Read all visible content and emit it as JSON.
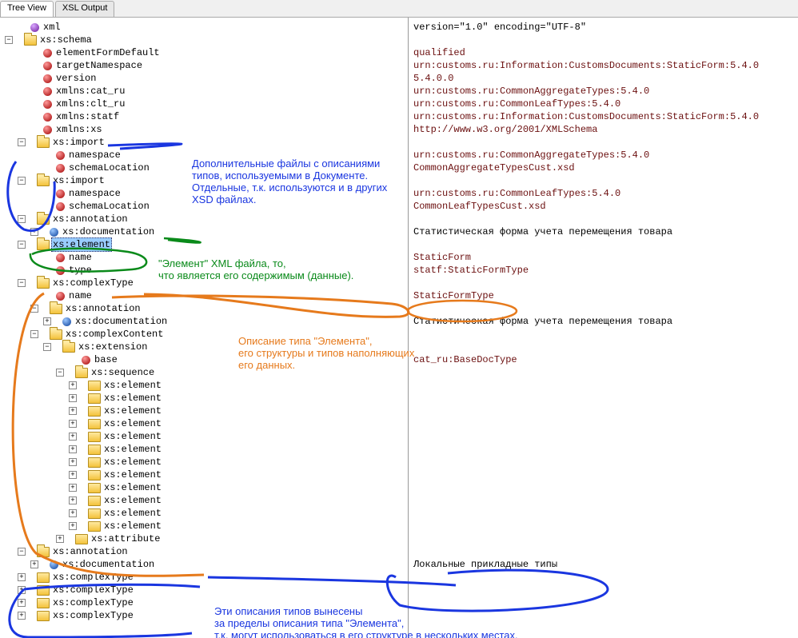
{
  "tabs": {
    "tree_view": "Tree View",
    "xsl_output": "XSL Output"
  },
  "tree": {
    "xml": "xml",
    "schema": "xs:schema",
    "attrs": {
      "elementFormDefault": "elementFormDefault",
      "targetNamespace": "targetNamespace",
      "version": "version",
      "xmlns_cat_ru": "xmlns:cat_ru",
      "xmlns_clt_ru": "xmlns:clt_ru",
      "xmlns_statf": "xmlns:statf",
      "xmlns_xs": "xmlns:xs"
    },
    "import1": {
      "label": "xs:import",
      "namespace": "namespace",
      "schemaLocation": "schemaLocation"
    },
    "import2": {
      "label": "xs:import",
      "namespace": "namespace",
      "schemaLocation": "schemaLocation"
    },
    "annotation": "xs:annotation",
    "documentation": "xs:documentation",
    "element": "xs:element",
    "name": "name",
    "type": "type",
    "complexType": "xs:complexType",
    "complexContent": "xs:complexContent",
    "extension": "xs:extension",
    "base": "base",
    "sequence": "xs:sequence",
    "xs_element": "xs:element",
    "xs_attribute": "xs:attribute"
  },
  "values": {
    "xml_decl": "version=\"1.0\" encoding=\"UTF-8\"",
    "qualified": "qualified",
    "targetNs": "urn:customs.ru:Information:CustomsDocuments:StaticForm:5.4.0",
    "version": "5.4.0.0",
    "cat_ru": "urn:customs.ru:CommonAggregateTypes:5.4.0",
    "clt_ru": "urn:customs.ru:CommonLeafTypes:5.4.0",
    "statf": "urn:customs.ru:Information:CustomsDocuments:StaticForm:5.4.0",
    "xs": "http://www.w3.org/2001/XMLSchema",
    "imp1_ns": "urn:customs.ru:CommonAggregateTypes:5.4.0",
    "imp1_loc": "CommonAggregateTypesCust.xsd",
    "imp2_ns": "urn:customs.ru:CommonLeafTypes:5.4.0",
    "imp2_loc": "CommonLeafTypesCust.xsd",
    "doc1": "Статистическая форма учета перемещения товара",
    "el_name": "StaticForm",
    "el_type": "statf:StaticFormType",
    "ct_name": "StaticFormType",
    "doc2": "Статистическая форма учета перемещения товара",
    "base": "cat_ru:BaseDocType",
    "doc3": "Локальные прикладные типы"
  },
  "annotations": {
    "blue1_line1": "Дополнительные файлы с описаниями",
    "blue1_line2": "типов, используемыми в Документе.",
    "blue1_line3": "Отдельные, т.к. используются и в других",
    "blue1_line4": "XSD файлах.",
    "green_line1": "\"Элемент\"  XML файла, то,",
    "green_line2": "что является его содержимым (данные).",
    "orange_line1": "Описание типа \"Элемента\",",
    "orange_line2": "его структуры и типов наполняющих",
    "orange_line3": "его данных.",
    "blue2_line1": "Эти описания типов вынесены",
    "blue2_line2": "за пределы описания типа \"Элемента\",",
    "blue2_line3": "т.к. могут использоваться в его структуре в нескольких местах."
  }
}
